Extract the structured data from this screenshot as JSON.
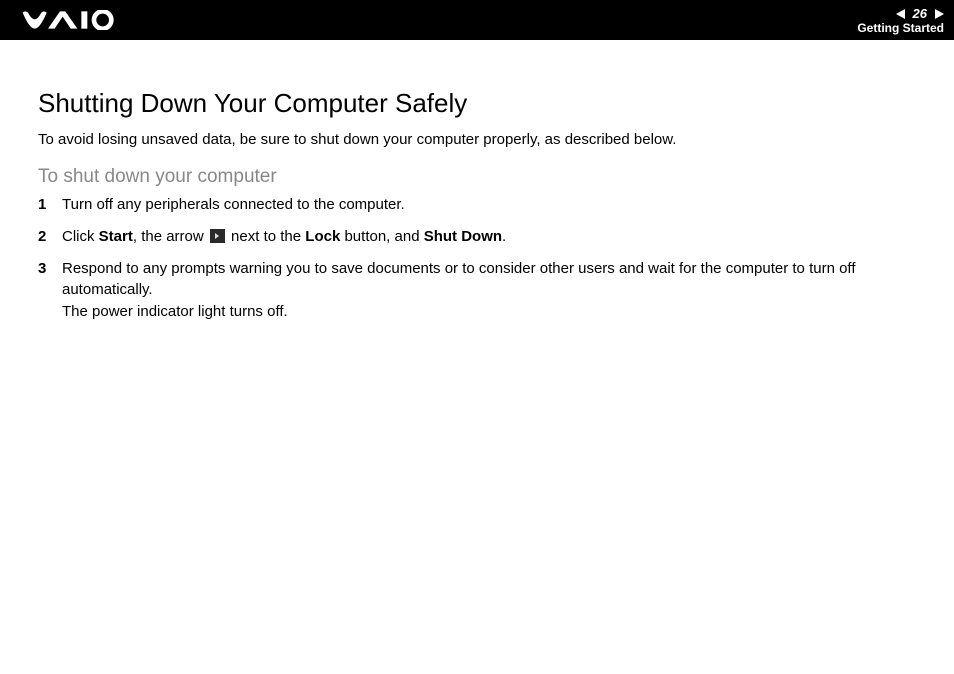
{
  "header": {
    "page_number": "26",
    "section": "Getting Started"
  },
  "page": {
    "title": "Shutting Down Your Computer Safely",
    "intro": "To avoid losing unsaved data, be sure to shut down your computer properly, as described below.",
    "subtitle": "To shut down your computer",
    "steps": {
      "s1": "Turn off any peripherals connected to the computer.",
      "s2": {
        "a": "Click ",
        "b": "Start",
        "c": ", the arrow ",
        "d": " next to the ",
        "e": "Lock",
        "f": " button, and ",
        "g": "Shut Down",
        "h": "."
      },
      "s3": {
        "a": "Respond to any prompts warning you to save documents or to consider other users and wait for the computer to turn off automatically.",
        "b": "The power indicator light turns off."
      }
    }
  }
}
